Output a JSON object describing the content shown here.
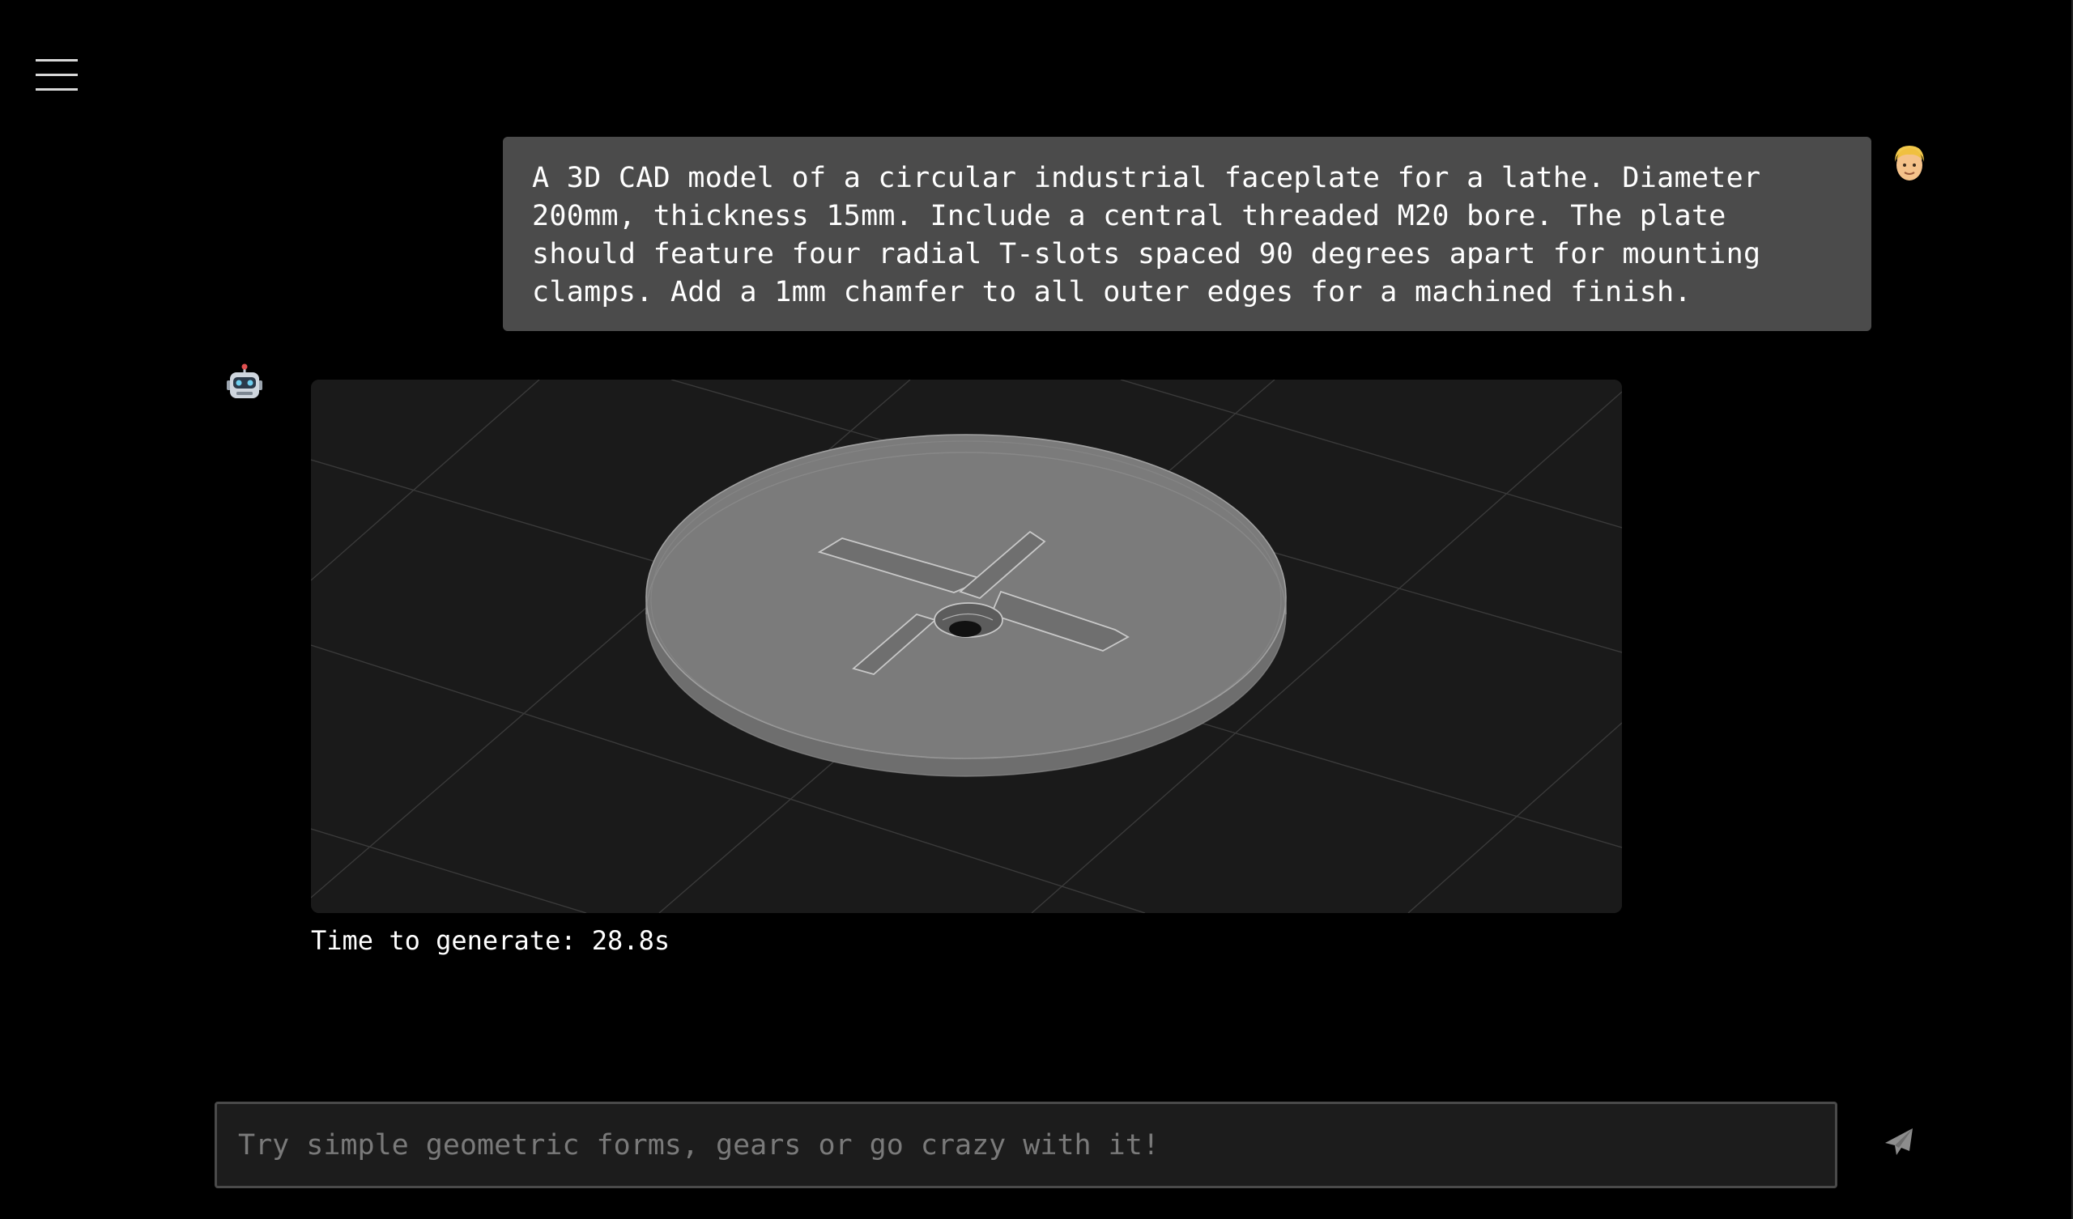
{
  "menu": {
    "icon": "hamburger-menu-icon"
  },
  "conversation": {
    "user_message": {
      "avatar": "blond-person-emoji",
      "avatar_glyph": "👱",
      "text": "A 3D CAD model of a circular industrial faceplate for a lathe. Diameter 200mm, thickness 15mm. Include a central threaded M20 bore. The plate should feature four radial T-slots spaced 90 degrees apart for mounting clamps. Add a 1mm chamfer to all outer edges for a machined finish."
    },
    "bot_message": {
      "avatar": "robot-emoji",
      "avatar_glyph": "🤖",
      "viewer": "3d-model-viewer",
      "generation_time_label": "Time to generate:",
      "generation_time_value": "28.8s"
    }
  },
  "composer": {
    "placeholder": "Try simple geometric forms, gears or go crazy with it!",
    "value": "",
    "send_icon": "paper-plane-send-icon"
  },
  "colors": {
    "background": "#000000",
    "user_bubble": "#4b4b4b",
    "viewer_background": "#1a1a1a",
    "model_surface": "#7a7a7a",
    "input_background": "#1c1c1c",
    "input_border": "#4a4a4a"
  }
}
